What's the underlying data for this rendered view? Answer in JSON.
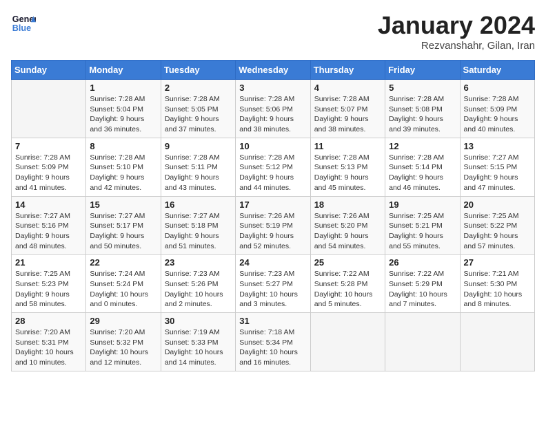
{
  "header": {
    "logo_line1": "General",
    "logo_line2": "Blue",
    "month_title": "January 2024",
    "subtitle": "Rezvanshahr, Gilan, Iran"
  },
  "days_of_week": [
    "Sunday",
    "Monday",
    "Tuesday",
    "Wednesday",
    "Thursday",
    "Friday",
    "Saturday"
  ],
  "weeks": [
    [
      {
        "day": "",
        "info": ""
      },
      {
        "day": "1",
        "info": "Sunrise: 7:28 AM\nSunset: 5:04 PM\nDaylight: 9 hours\nand 36 minutes."
      },
      {
        "day": "2",
        "info": "Sunrise: 7:28 AM\nSunset: 5:05 PM\nDaylight: 9 hours\nand 37 minutes."
      },
      {
        "day": "3",
        "info": "Sunrise: 7:28 AM\nSunset: 5:06 PM\nDaylight: 9 hours\nand 38 minutes."
      },
      {
        "day": "4",
        "info": "Sunrise: 7:28 AM\nSunset: 5:07 PM\nDaylight: 9 hours\nand 38 minutes."
      },
      {
        "day": "5",
        "info": "Sunrise: 7:28 AM\nSunset: 5:08 PM\nDaylight: 9 hours\nand 39 minutes."
      },
      {
        "day": "6",
        "info": "Sunrise: 7:28 AM\nSunset: 5:09 PM\nDaylight: 9 hours\nand 40 minutes."
      }
    ],
    [
      {
        "day": "7",
        "info": "Sunrise: 7:28 AM\nSunset: 5:09 PM\nDaylight: 9 hours\nand 41 minutes."
      },
      {
        "day": "8",
        "info": "Sunrise: 7:28 AM\nSunset: 5:10 PM\nDaylight: 9 hours\nand 42 minutes."
      },
      {
        "day": "9",
        "info": "Sunrise: 7:28 AM\nSunset: 5:11 PM\nDaylight: 9 hours\nand 43 minutes."
      },
      {
        "day": "10",
        "info": "Sunrise: 7:28 AM\nSunset: 5:12 PM\nDaylight: 9 hours\nand 44 minutes."
      },
      {
        "day": "11",
        "info": "Sunrise: 7:28 AM\nSunset: 5:13 PM\nDaylight: 9 hours\nand 45 minutes."
      },
      {
        "day": "12",
        "info": "Sunrise: 7:28 AM\nSunset: 5:14 PM\nDaylight: 9 hours\nand 46 minutes."
      },
      {
        "day": "13",
        "info": "Sunrise: 7:27 AM\nSunset: 5:15 PM\nDaylight: 9 hours\nand 47 minutes."
      }
    ],
    [
      {
        "day": "14",
        "info": "Sunrise: 7:27 AM\nSunset: 5:16 PM\nDaylight: 9 hours\nand 48 minutes."
      },
      {
        "day": "15",
        "info": "Sunrise: 7:27 AM\nSunset: 5:17 PM\nDaylight: 9 hours\nand 50 minutes."
      },
      {
        "day": "16",
        "info": "Sunrise: 7:27 AM\nSunset: 5:18 PM\nDaylight: 9 hours\nand 51 minutes."
      },
      {
        "day": "17",
        "info": "Sunrise: 7:26 AM\nSunset: 5:19 PM\nDaylight: 9 hours\nand 52 minutes."
      },
      {
        "day": "18",
        "info": "Sunrise: 7:26 AM\nSunset: 5:20 PM\nDaylight: 9 hours\nand 54 minutes."
      },
      {
        "day": "19",
        "info": "Sunrise: 7:25 AM\nSunset: 5:21 PM\nDaylight: 9 hours\nand 55 minutes."
      },
      {
        "day": "20",
        "info": "Sunrise: 7:25 AM\nSunset: 5:22 PM\nDaylight: 9 hours\nand 57 minutes."
      }
    ],
    [
      {
        "day": "21",
        "info": "Sunrise: 7:25 AM\nSunset: 5:23 PM\nDaylight: 9 hours\nand 58 minutes."
      },
      {
        "day": "22",
        "info": "Sunrise: 7:24 AM\nSunset: 5:24 PM\nDaylight: 10 hours\nand 0 minutes."
      },
      {
        "day": "23",
        "info": "Sunrise: 7:23 AM\nSunset: 5:26 PM\nDaylight: 10 hours\nand 2 minutes."
      },
      {
        "day": "24",
        "info": "Sunrise: 7:23 AM\nSunset: 5:27 PM\nDaylight: 10 hours\nand 3 minutes."
      },
      {
        "day": "25",
        "info": "Sunrise: 7:22 AM\nSunset: 5:28 PM\nDaylight: 10 hours\nand 5 minutes."
      },
      {
        "day": "26",
        "info": "Sunrise: 7:22 AM\nSunset: 5:29 PM\nDaylight: 10 hours\nand 7 minutes."
      },
      {
        "day": "27",
        "info": "Sunrise: 7:21 AM\nSunset: 5:30 PM\nDaylight: 10 hours\nand 8 minutes."
      }
    ],
    [
      {
        "day": "28",
        "info": "Sunrise: 7:20 AM\nSunset: 5:31 PM\nDaylight: 10 hours\nand 10 minutes."
      },
      {
        "day": "29",
        "info": "Sunrise: 7:20 AM\nSunset: 5:32 PM\nDaylight: 10 hours\nand 12 minutes."
      },
      {
        "day": "30",
        "info": "Sunrise: 7:19 AM\nSunset: 5:33 PM\nDaylight: 10 hours\nand 14 minutes."
      },
      {
        "day": "31",
        "info": "Sunrise: 7:18 AM\nSunset: 5:34 PM\nDaylight: 10 hours\nand 16 minutes."
      },
      {
        "day": "",
        "info": ""
      },
      {
        "day": "",
        "info": ""
      },
      {
        "day": "",
        "info": ""
      }
    ]
  ]
}
